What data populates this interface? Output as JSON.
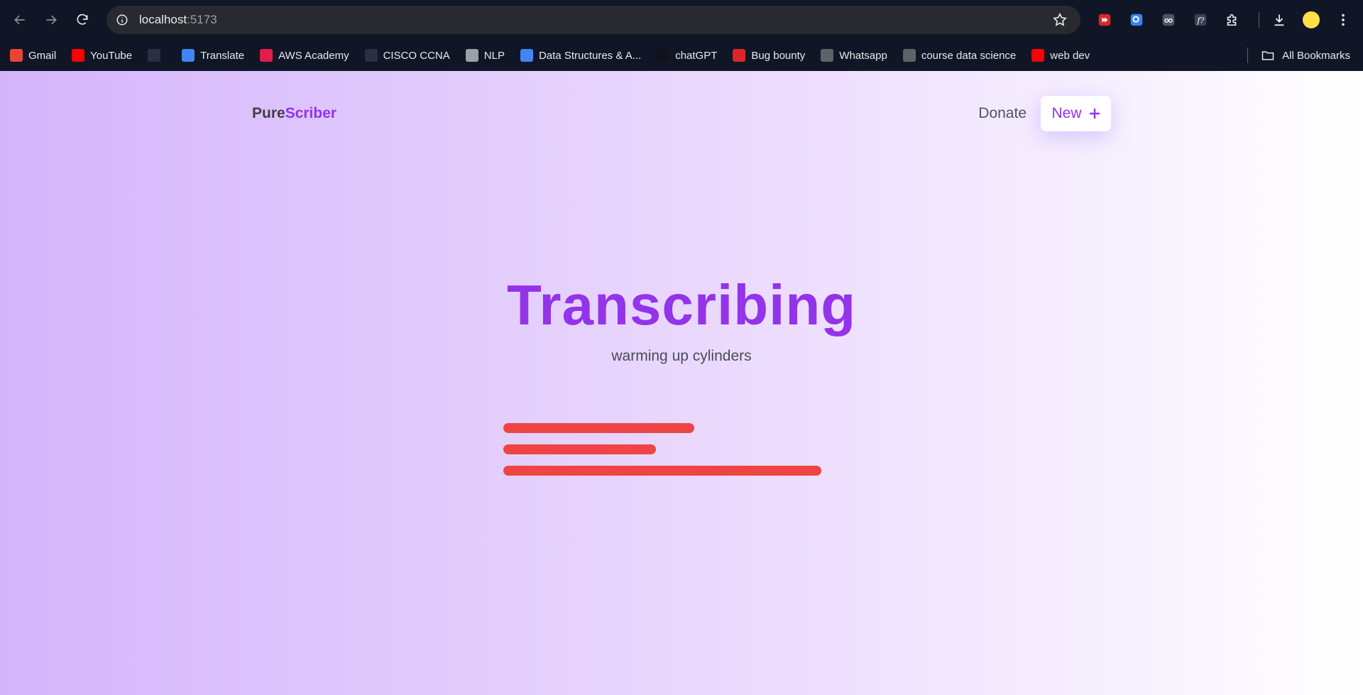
{
  "browser": {
    "url_host": "localhost",
    "url_port": ":5173",
    "bookmarks": [
      {
        "label": "Gmail",
        "color": "#ea4335",
        "icon": "gmail-icon"
      },
      {
        "label": "YouTube",
        "color": "#ff0000",
        "icon": "youtube-icon"
      },
      {
        "label": "",
        "color": "#2a3042",
        "icon": "grid-icon"
      },
      {
        "label": "Translate",
        "color": "#4285f4",
        "icon": "translate-icon"
      },
      {
        "label": "AWS Academy",
        "color": "#e11d48",
        "icon": "aws-icon"
      },
      {
        "label": "CISCO CCNA",
        "color": "#2a3042",
        "icon": "grid-icon"
      },
      {
        "label": "NLP",
        "color": "#9aa0a6",
        "icon": "nlp-icon"
      },
      {
        "label": "Data Structures & A...",
        "color": "#4285f4",
        "icon": "dsa-icon"
      },
      {
        "label": "chatGPT",
        "color": "#10131c",
        "icon": "chatgpt-icon"
      },
      {
        "label": "Bug bounty",
        "color": "#dc2626",
        "icon": "bug-icon"
      },
      {
        "label": "Whatsapp",
        "color": "#5f6368",
        "icon": "globe-icon"
      },
      {
        "label": "course data science",
        "color": "#5f6368",
        "icon": "globe-icon"
      },
      {
        "label": "web dev",
        "color": "#ff0000",
        "icon": "youtube-icon"
      }
    ],
    "all_bookmarks": "All Bookmarks"
  },
  "app": {
    "logo_part1": "Pure",
    "logo_part2": "Scriber",
    "donate": "Donate",
    "new_label": "New",
    "title": "Transcribing",
    "subtitle": "warming up cylinders"
  },
  "loading_bars": [
    {
      "fraction": 0.6
    },
    {
      "fraction": 0.48
    },
    {
      "fraction": 1.0
    }
  ],
  "colors": {
    "accent": "#9333ea",
    "bar": "#ef4444"
  }
}
